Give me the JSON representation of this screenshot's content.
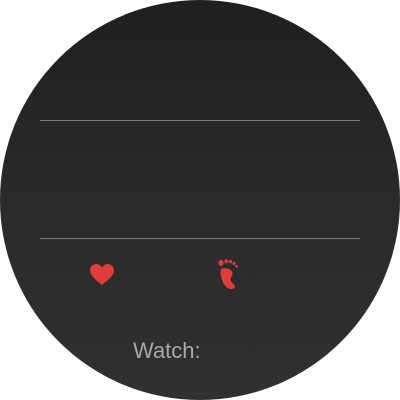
{
  "screen": {
    "background": "#2a2a2a",
    "divider_color": "#7a7a7a"
  },
  "top_section": {
    "text": ""
  },
  "middle_section": {
    "text": ""
  },
  "stats": {
    "heart_rate": {
      "icon": "heart-icon",
      "color": "#e03c3c",
      "value": ""
    },
    "steps": {
      "icon": "footprint-icon",
      "color": "#e03c3c",
      "value": ""
    }
  },
  "footer": {
    "label": "Watch:",
    "value": ""
  }
}
